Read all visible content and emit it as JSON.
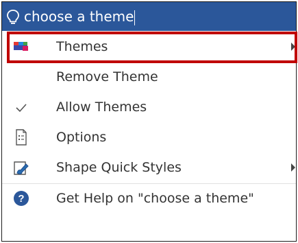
{
  "search": {
    "query": "choose a theme",
    "icon": "lightbulb-icon"
  },
  "menu": {
    "items": [
      {
        "label": "Themes",
        "icon": "themes-icon",
        "submenu": true
      },
      {
        "label": "Remove Theme",
        "icon": "",
        "submenu": false
      },
      {
        "label": "Allow Themes",
        "icon": "checkmark-icon",
        "submenu": false
      },
      {
        "label": "Options",
        "icon": "options-icon",
        "submenu": false
      },
      {
        "label": "Shape Quick Styles",
        "icon": "shape-quick-styles-icon",
        "submenu": true
      },
      {
        "label": "Get Help on \"choose a theme\"",
        "icon": "help-icon",
        "submenu": false
      }
    ]
  },
  "colors": {
    "header": "#2b579a",
    "highlight_border": "#c00000",
    "help_icon": "#2b579a"
  }
}
